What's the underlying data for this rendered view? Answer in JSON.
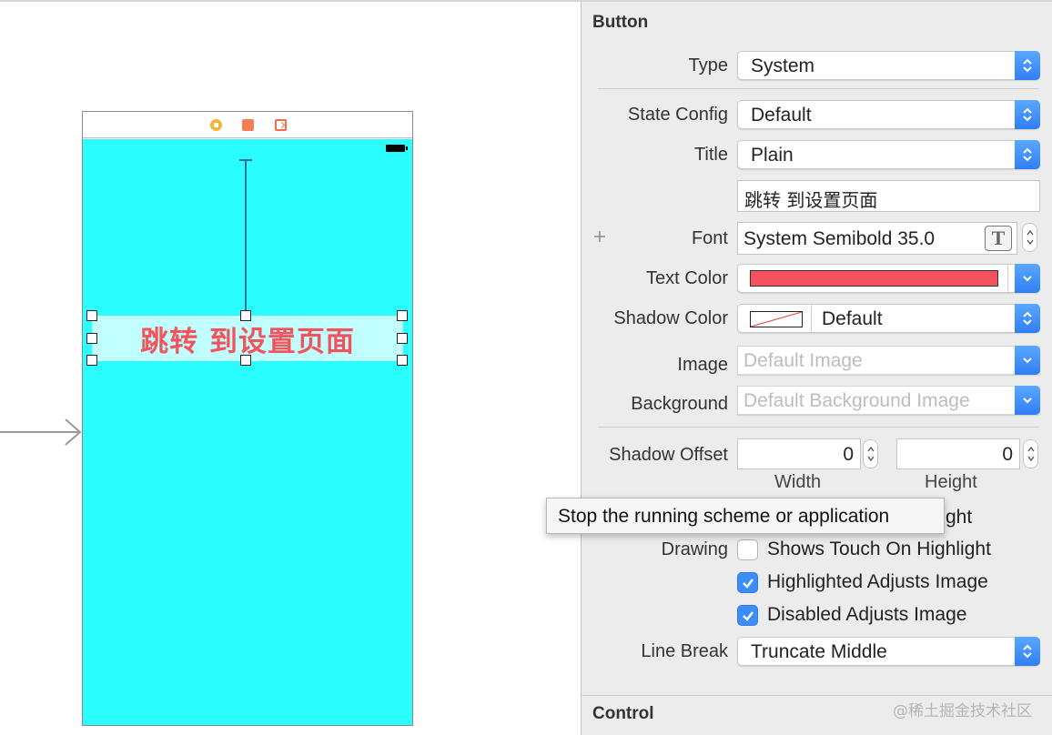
{
  "canvas": {
    "button_title": "跳转 到设置页面"
  },
  "inspector": {
    "section_title": "Button",
    "type": {
      "label": "Type",
      "value": "System"
    },
    "state_config": {
      "label": "State Config",
      "value": "Default"
    },
    "title": {
      "label": "Title",
      "value": "Plain"
    },
    "title_text": "跳转 到设置页面",
    "font": {
      "label": "Font",
      "value": "System Semibold 35.0"
    },
    "text_color": {
      "label": "Text Color",
      "swatch": "#f5525f"
    },
    "shadow_color": {
      "label": "Shadow Color",
      "value": "Default"
    },
    "image": {
      "label": "Image",
      "placeholder": "Default Image"
    },
    "background": {
      "label": "Background",
      "placeholder": "Default Background Image"
    },
    "shadow_offset": {
      "label": "Shadow Offset",
      "width_value": "0",
      "height_value": "0",
      "width_label": "Width",
      "height_label": "Height"
    },
    "reverses_partial": "ght",
    "drawing": {
      "label": "Drawing",
      "options": [
        {
          "label": "Shows Touch On Highlight",
          "checked": false
        },
        {
          "label": "Highlighted Adjusts Image",
          "checked": true
        },
        {
          "label": "Disabled Adjusts Image",
          "checked": true
        }
      ]
    },
    "line_break": {
      "label": "Line Break",
      "value": "Truncate Middle"
    },
    "next_section_title": "Control"
  },
  "tooltip": "Stop the running scheme or application",
  "watermark": "@稀土掘金技术社区",
  "colors": {
    "view_background": "#2afdfd",
    "title_color": "#f2545d",
    "accent": "#3c8df5"
  }
}
